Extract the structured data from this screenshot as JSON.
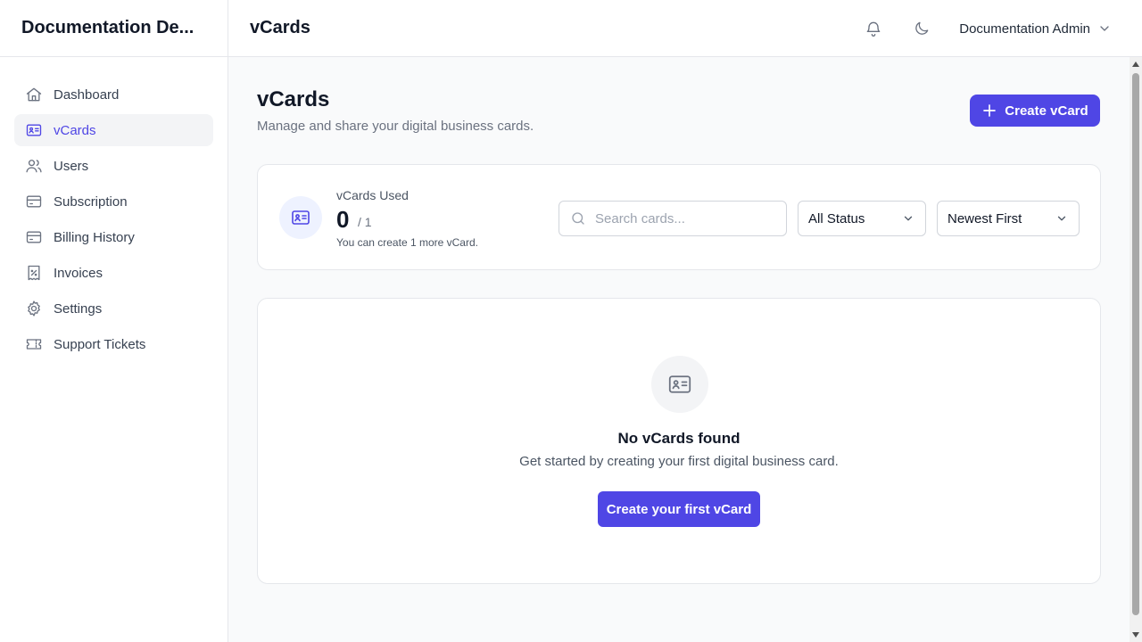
{
  "app": {
    "brand": "Documentation De..."
  },
  "sidebar": {
    "items": [
      {
        "label": "Dashboard",
        "icon": "home-icon",
        "active": false
      },
      {
        "label": "vCards",
        "icon": "id-card-icon",
        "active": true
      },
      {
        "label": "Users",
        "icon": "users-icon",
        "active": false
      },
      {
        "label": "Subscription",
        "icon": "credit-card-icon",
        "active": false
      },
      {
        "label": "Billing History",
        "icon": "credit-card-icon",
        "active": false
      },
      {
        "label": "Invoices",
        "icon": "receipt-icon",
        "active": false
      },
      {
        "label": "Settings",
        "icon": "gear-icon",
        "active": false
      },
      {
        "label": "Support Tickets",
        "icon": "ticket-icon",
        "active": false
      }
    ]
  },
  "header": {
    "title": "vCards",
    "notification_icon": "bell-icon",
    "theme_icon": "moon-icon",
    "user_name": "Documentation Admin"
  },
  "page": {
    "title": "vCards",
    "subtitle": "Manage and share your digital business cards.",
    "create_button": "Create vCard"
  },
  "stats": {
    "label": "vCards Used",
    "count": "0",
    "limit": "/ 1",
    "note": "You can create 1 more vCard."
  },
  "filters": {
    "search_placeholder": "Search cards...",
    "search_value": "",
    "status_selected": "All Status",
    "sort_selected": "Newest First"
  },
  "empty_state": {
    "title": "No vCards found",
    "subtitle": "Get started by creating your first digital business card.",
    "button": "Create your first vCard"
  },
  "colors": {
    "accent": "#4f46e5",
    "accent_light": "#eef2ff",
    "border": "#e5e7eb",
    "background": "#f9fafb"
  }
}
